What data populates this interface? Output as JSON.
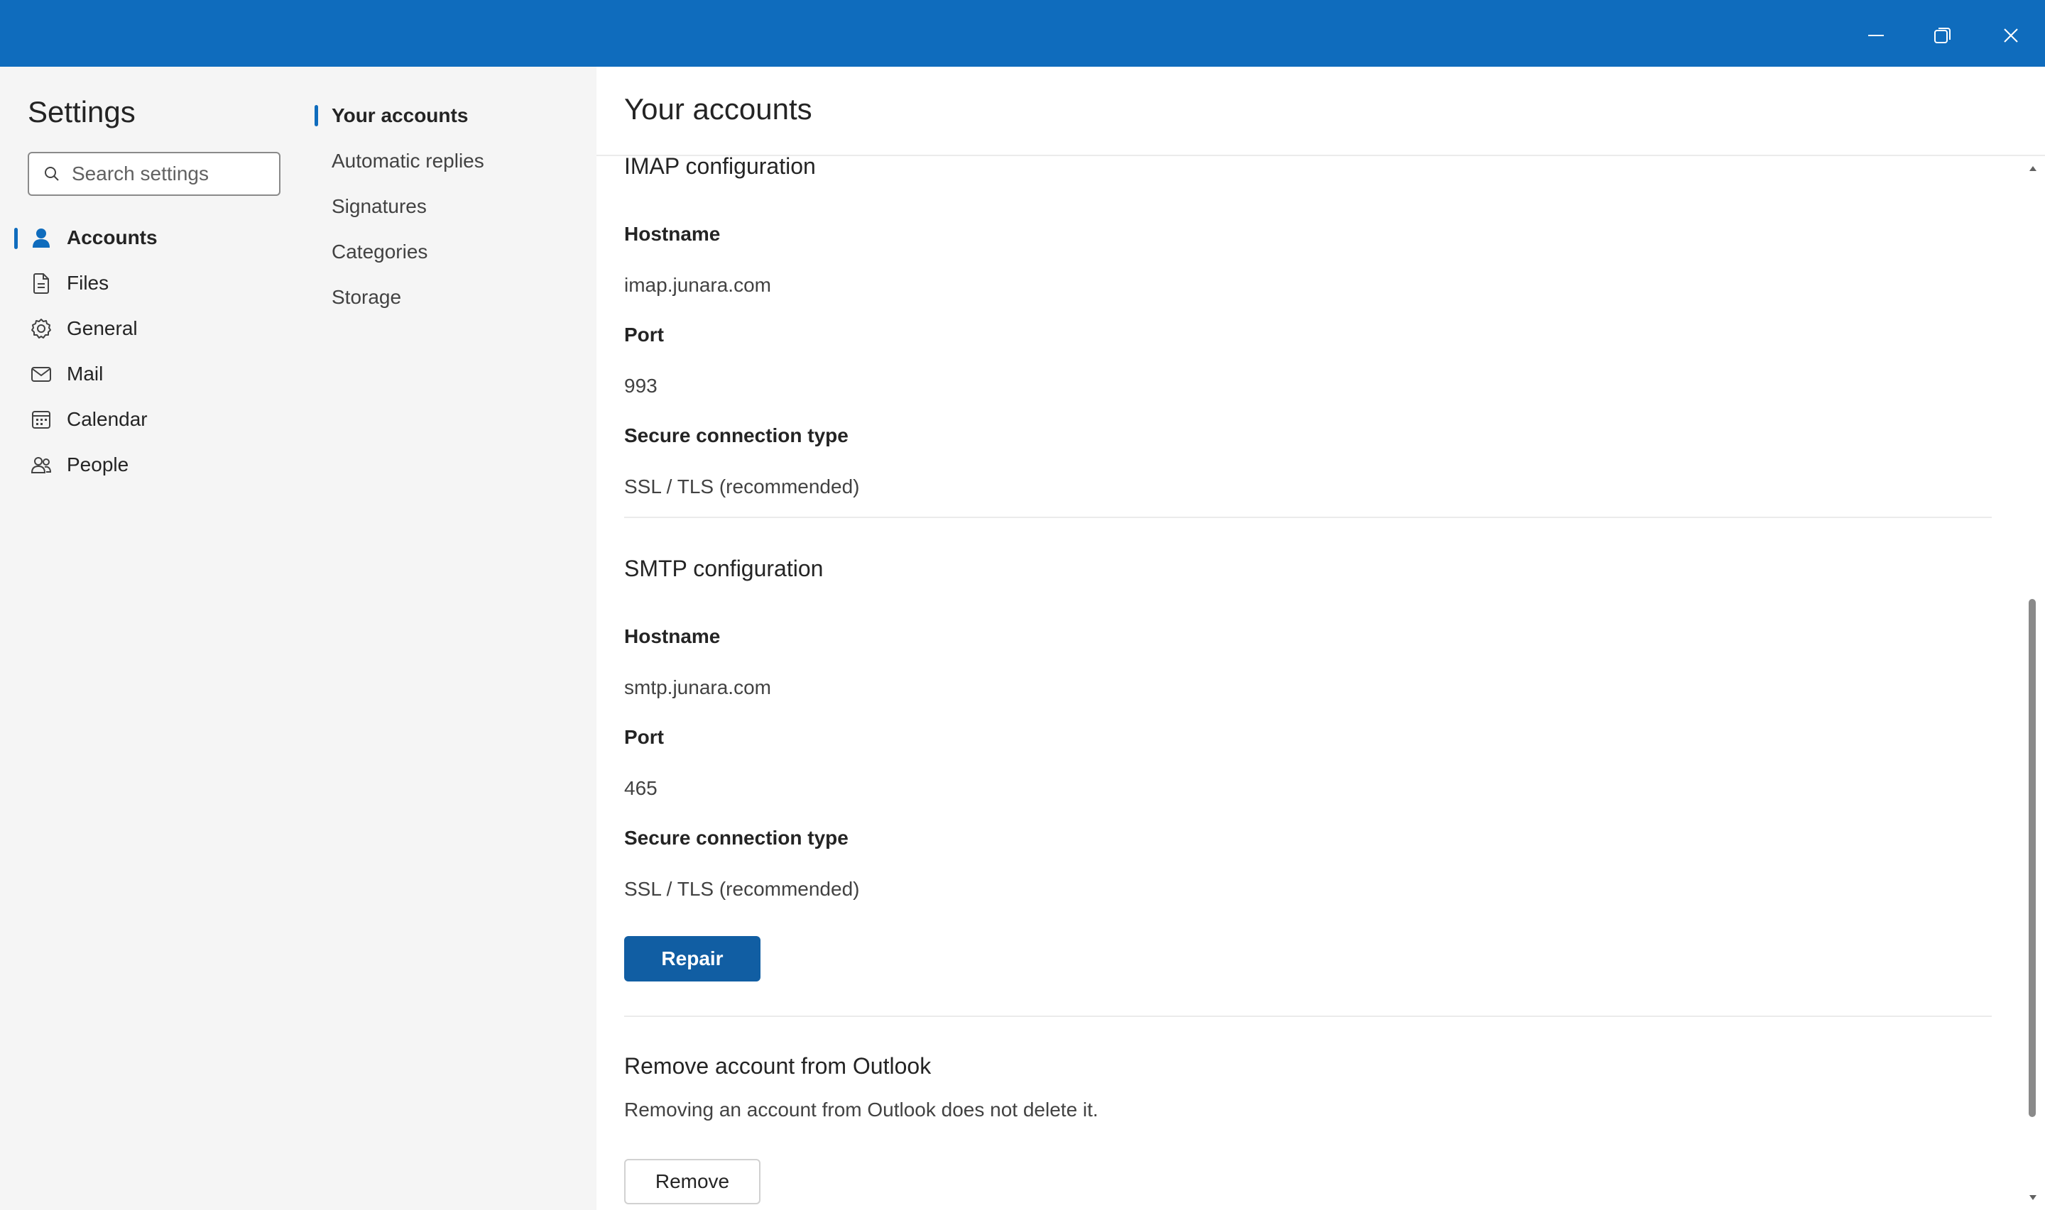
{
  "window": {
    "minimize_icon": "minimize-icon",
    "restore_icon": "restore-icon",
    "close_icon": "close-icon",
    "accent_color": "#0f6cbd"
  },
  "settings": {
    "title": "Settings",
    "search": {
      "placeholder": "Search settings",
      "value": ""
    },
    "nav": [
      {
        "label": "Accounts",
        "icon": "person-icon",
        "active": true
      },
      {
        "label": "Files",
        "icon": "document-icon"
      },
      {
        "label": "General",
        "icon": "gear-icon"
      },
      {
        "label": "Mail",
        "icon": "mail-icon"
      },
      {
        "label": "Calendar",
        "icon": "calendar-icon"
      },
      {
        "label": "People",
        "icon": "people-icon"
      }
    ],
    "subnav": [
      {
        "label": "Your accounts",
        "active": true
      },
      {
        "label": "Automatic replies"
      },
      {
        "label": "Signatures"
      },
      {
        "label": "Categories"
      },
      {
        "label": "Storage"
      }
    ]
  },
  "main": {
    "title": "Your accounts",
    "imap": {
      "title": "IMAP configuration",
      "hostname_label": "Hostname",
      "hostname_value": "imap.junara.com",
      "port_label": "Port",
      "port_value": "993",
      "security_label": "Secure connection type",
      "security_value": "SSL / TLS (recommended)"
    },
    "smtp": {
      "title": "SMTP configuration",
      "hostname_label": "Hostname",
      "hostname_value": "smtp.junara.com",
      "port_label": "Port",
      "port_value": "465",
      "security_label": "Secure connection type",
      "security_value": "SSL / TLS (recommended)"
    },
    "repair_button": "Repair",
    "remove": {
      "title": "Remove account from Outlook",
      "description": "Removing an account from Outlook does not delete it.",
      "button": "Remove"
    }
  }
}
